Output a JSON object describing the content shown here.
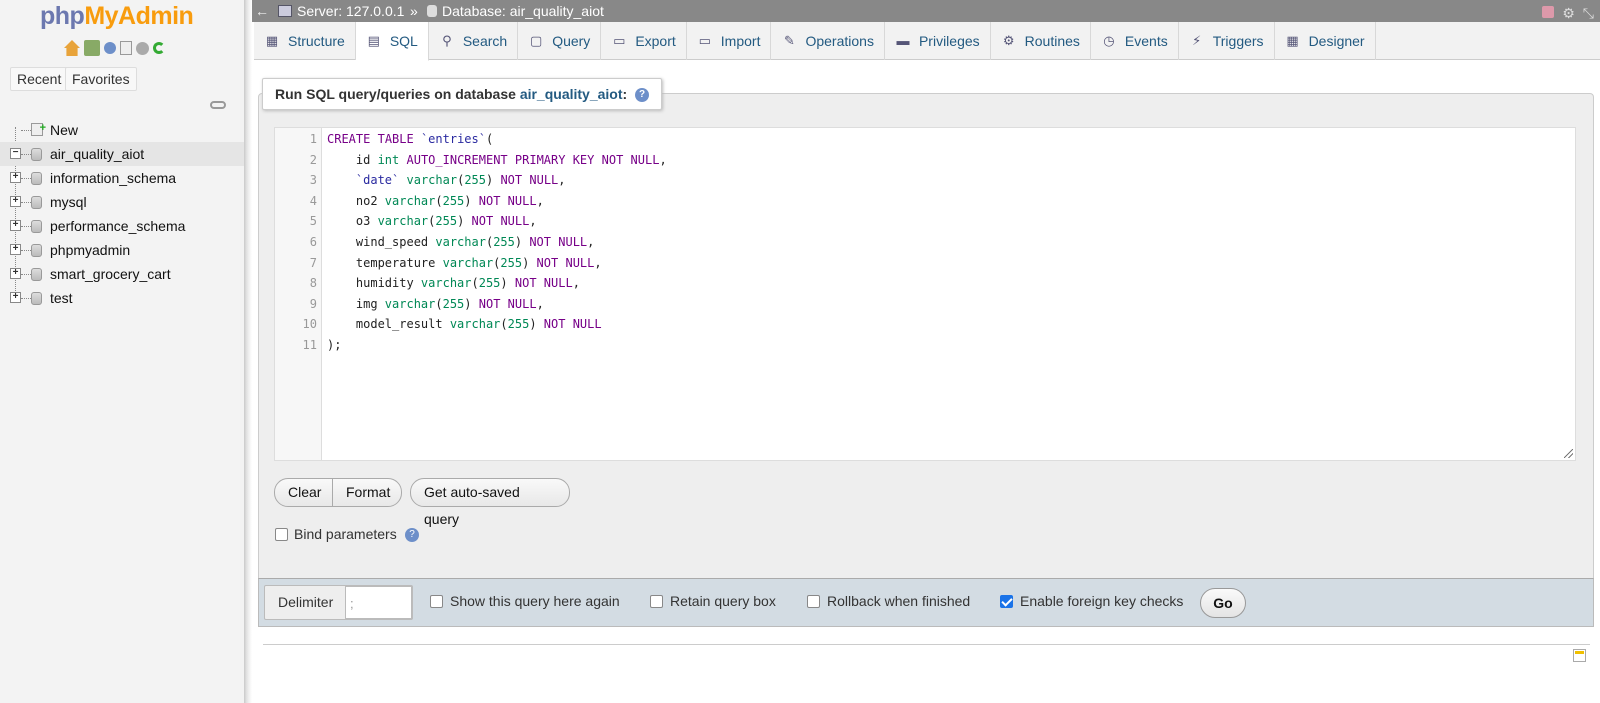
{
  "nav": {
    "logo_php": "php",
    "logo_myadmin": "MyAdmin",
    "recent_label": "Recent",
    "favorites_label": "Favorites",
    "tree": [
      {
        "label": "New",
        "kind": "new"
      },
      {
        "label": "air_quality_aiot",
        "kind": "db",
        "expanded": true,
        "active": true
      },
      {
        "label": "information_schema",
        "kind": "db"
      },
      {
        "label": "mysql",
        "kind": "db"
      },
      {
        "label": "performance_schema",
        "kind": "db"
      },
      {
        "label": "phpmyadmin",
        "kind": "db"
      },
      {
        "label": "smart_grocery_cart",
        "kind": "db"
      },
      {
        "label": "test",
        "kind": "db"
      }
    ]
  },
  "topbar": {
    "back": "←",
    "server": "Server: 127.0.0.1",
    "separator": "»",
    "database": "Database: air_quality_aiot"
  },
  "tabs": [
    {
      "label": "Structure",
      "icon": "structure-icon",
      "glyph": "▦"
    },
    {
      "label": "SQL",
      "icon": "sql-icon",
      "glyph": "▤",
      "active": true
    },
    {
      "label": "Search",
      "icon": "search-icon",
      "glyph": "⚲"
    },
    {
      "label": "Query",
      "icon": "query-icon",
      "glyph": "▢"
    },
    {
      "label": "Export",
      "icon": "export-icon",
      "glyph": "▭"
    },
    {
      "label": "Import",
      "icon": "import-icon",
      "glyph": "▭"
    },
    {
      "label": "Operations",
      "icon": "wrench-icon",
      "glyph": "✎"
    },
    {
      "label": "Privileges",
      "icon": "privileges-icon",
      "glyph": "▬"
    },
    {
      "label": "Routines",
      "icon": "routines-icon",
      "glyph": "⚙"
    },
    {
      "label": "Events",
      "icon": "clock-icon",
      "glyph": "◷"
    },
    {
      "label": "Triggers",
      "icon": "triggers-icon",
      "glyph": "⚡"
    },
    {
      "label": "Designer",
      "icon": "designer-icon",
      "glyph": "▦"
    }
  ],
  "panel": {
    "legend_prefix": "Run SQL query/queries on database",
    "legend_db": "air_quality_aiot",
    "legend_suffix": ":",
    "code_lines": [
      "CREATE TABLE `entries`(",
      "    id int AUTO_INCREMENT PRIMARY KEY NOT NULL,",
      "    `date` varchar(255) NOT NULL,",
      "    no2 varchar(255) NOT NULL,",
      "    o3 varchar(255) NOT NULL,",
      "    wind_speed varchar(255) NOT NULL,",
      "    temperature varchar(255) NOT NULL,",
      "    humidity varchar(255) NOT NULL,",
      "    img varchar(255) NOT NULL,",
      "    model_result varchar(255) NOT NULL",
      ");"
    ],
    "clear_label": "Clear",
    "format_label": "Format",
    "autosave_label": "Get auto-saved query",
    "bind_params_label": "Bind parameters"
  },
  "bottombar": {
    "delimiter_label": "Delimiter",
    "delimiter_value": ";",
    "show_query_label": "Show this query here again",
    "show_query_checked": false,
    "retain_box_label": "Retain query box",
    "retain_box_checked": false,
    "rollback_label": "Rollback when finished",
    "rollback_checked": false,
    "fk_checks_label": "Enable foreign key checks",
    "fk_checks_checked": true,
    "go_label": "Go"
  }
}
